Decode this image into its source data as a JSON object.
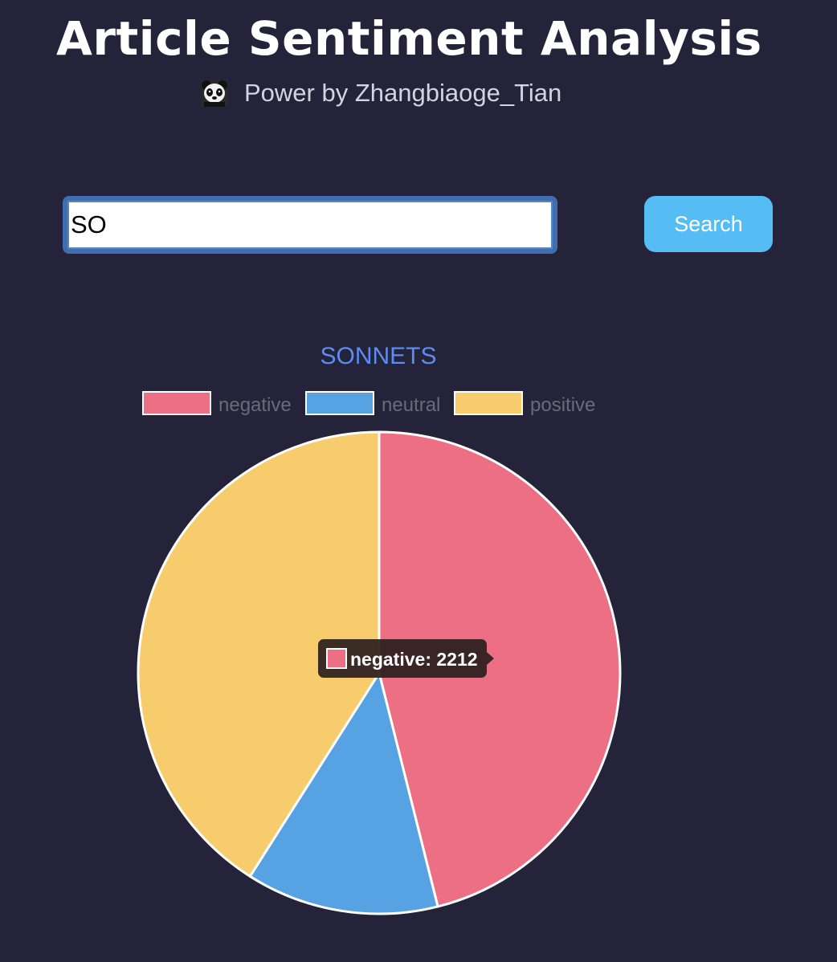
{
  "header": {
    "title": "Article Sentiment Analysis",
    "byline": "Power by Zhangbiaoge_Tian",
    "avatar_icon": "panda-icon"
  },
  "search": {
    "value": "SO",
    "button_label": "Search"
  },
  "colors": {
    "background": "#242339",
    "accent": "#55bdf4",
    "title": "#5b8df0",
    "legend_text": "#6b6b78"
  },
  "chart_data": {
    "type": "pie",
    "title": "SONNETS",
    "legend_position": "top",
    "categories": [
      "negative",
      "neutral",
      "positive"
    ],
    "values": [
      2212,
      620,
      1968
    ],
    "colors": [
      "#ec6f84",
      "#57a2e3",
      "#f6cc6d"
    ],
    "tooltip": {
      "category": "negative",
      "value": 2212,
      "text": "negative: 2212"
    }
  }
}
